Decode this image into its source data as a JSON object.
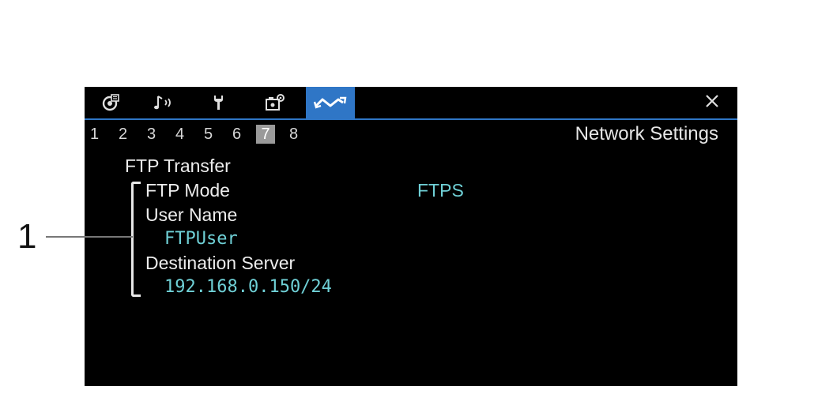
{
  "tabs": [
    {
      "icon": "camera-settings-icon",
      "active": false
    },
    {
      "icon": "audio-icon",
      "active": false
    },
    {
      "icon": "wrench-icon",
      "active": false
    },
    {
      "icon": "custom-settings-icon",
      "active": false
    },
    {
      "icon": "network-icon",
      "active": true
    }
  ],
  "close_icon": "close-icon",
  "page_numbers": [
    "1",
    "2",
    "3",
    "4",
    "5",
    "6",
    "7",
    "8"
  ],
  "active_page": "7",
  "menu_title": "Network Settings",
  "section": {
    "title": "FTP Transfer",
    "ftp_mode_label": "FTP Mode",
    "ftp_mode_value": "FTPS",
    "user_name_label": "User Name",
    "user_name_value": "FTPUser",
    "destination_label": "Destination Server",
    "destination_value": "192.168.0.150/24"
  },
  "callout": {
    "number": "1"
  },
  "colors": {
    "accent": "#2f76c6",
    "value_text": "#6fd0d6",
    "screen_bg": "#000000"
  }
}
